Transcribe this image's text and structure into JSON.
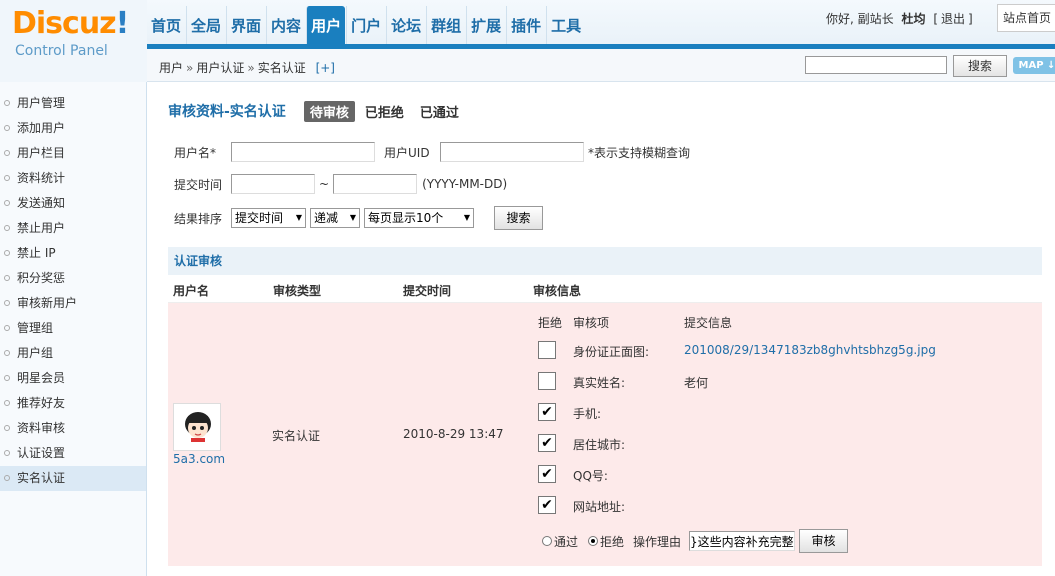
{
  "logo": {
    "brand_main": "Discuz",
    "brand_bang": "!",
    "subtitle": "Control Panel"
  },
  "topnav": [
    {
      "label": "首页",
      "active": false
    },
    {
      "label": "全局",
      "active": false
    },
    {
      "label": "界面",
      "active": false
    },
    {
      "label": "内容",
      "active": false
    },
    {
      "label": "用户",
      "active": true
    },
    {
      "label": "门户",
      "active": false
    },
    {
      "label": "论坛",
      "active": false
    },
    {
      "label": "群组",
      "active": false
    },
    {
      "label": "扩展",
      "active": false
    },
    {
      "label": "插件",
      "active": false
    },
    {
      "label": "工具",
      "active": false
    }
  ],
  "header": {
    "greeting": "你好, 副站长",
    "username": "杜均",
    "logout_open": "[",
    "logout": "退出",
    "logout_close": "]",
    "site_home": "站点首页"
  },
  "breadcrumb": {
    "items": [
      "用户",
      "用户认证",
      "实名认证"
    ],
    "sep": "»",
    "plus": "[+]"
  },
  "crumb_search": {
    "value": "",
    "button": "搜索",
    "map": "MAP ↓"
  },
  "sidebar": [
    {
      "label": "用户管理",
      "active": false
    },
    {
      "label": "添加用户",
      "active": false
    },
    {
      "label": "用户栏目",
      "active": false
    },
    {
      "label": "资料统计",
      "active": false
    },
    {
      "label": "发送通知",
      "active": false
    },
    {
      "label": "禁止用户",
      "active": false
    },
    {
      "label": "禁止 IP",
      "active": false
    },
    {
      "label": "积分奖惩",
      "active": false
    },
    {
      "label": "审核新用户",
      "active": false
    },
    {
      "label": "管理组",
      "active": false
    },
    {
      "label": "用户组",
      "active": false
    },
    {
      "label": "明星会员",
      "active": false
    },
    {
      "label": "推荐好友",
      "active": false
    },
    {
      "label": "资料审核",
      "active": false
    },
    {
      "label": "认证设置",
      "active": false
    },
    {
      "label": "实名认证",
      "active": true
    }
  ],
  "main": {
    "title": "审核资料-实名认证",
    "tabs": [
      {
        "label": "待审核",
        "active": true
      },
      {
        "label": "已拒绝",
        "active": false
      },
      {
        "label": "已通过",
        "active": false
      }
    ],
    "filters": {
      "username_label": "用户名*",
      "username_value": "",
      "uid_label": "用户UID",
      "uid_value": "",
      "fuzzy_note": "*表示支持模糊查询",
      "time_label": "提交时间",
      "time_from": "",
      "time_sep": "~",
      "time_to": "",
      "time_hint": "(YYYY-MM-DD)",
      "sort_label": "结果排序",
      "sort_field": "提交时间",
      "sort_order": "递减",
      "per_page": "每页显示10个",
      "search_button": "搜索"
    },
    "section_title": "认证审核",
    "columns": [
      "用户名",
      "审核类型",
      "提交时间",
      "审核信息"
    ],
    "row": {
      "username": "5a3.com",
      "type": "实名认证",
      "time": "2010-8-29 13:47",
      "info_headers": [
        "拒绝",
        "审核项",
        "提交信息"
      ],
      "verify_items": [
        {
          "label": "身份证正面图:",
          "value": "201008/29/1347183zb8ghvhtsbhzg5g.jpg",
          "checked": false,
          "is_link": true
        },
        {
          "label": "真实姓名:",
          "value": "老何",
          "checked": false,
          "is_link": false
        },
        {
          "label": "手机:",
          "value": "",
          "checked": true,
          "is_link": false
        },
        {
          "label": "居住城市:",
          "value": "",
          "checked": true,
          "is_link": false
        },
        {
          "label": "QQ号:",
          "value": "",
          "checked": true,
          "is_link": false
        },
        {
          "label": "网站地址:",
          "value": "",
          "checked": true,
          "is_link": false
        }
      ],
      "approve_label": "通过",
      "reject_label": "拒绝",
      "selected": "reject",
      "reason_label": "操作理由",
      "reason_value": "}这些内容补充完整",
      "review_button": "审核"
    }
  },
  "colors": {
    "accent": "#1a7fbf",
    "link": "#1f6ea8",
    "row_bg": "#fdeaea",
    "logo_orange": "#ff8c00"
  }
}
